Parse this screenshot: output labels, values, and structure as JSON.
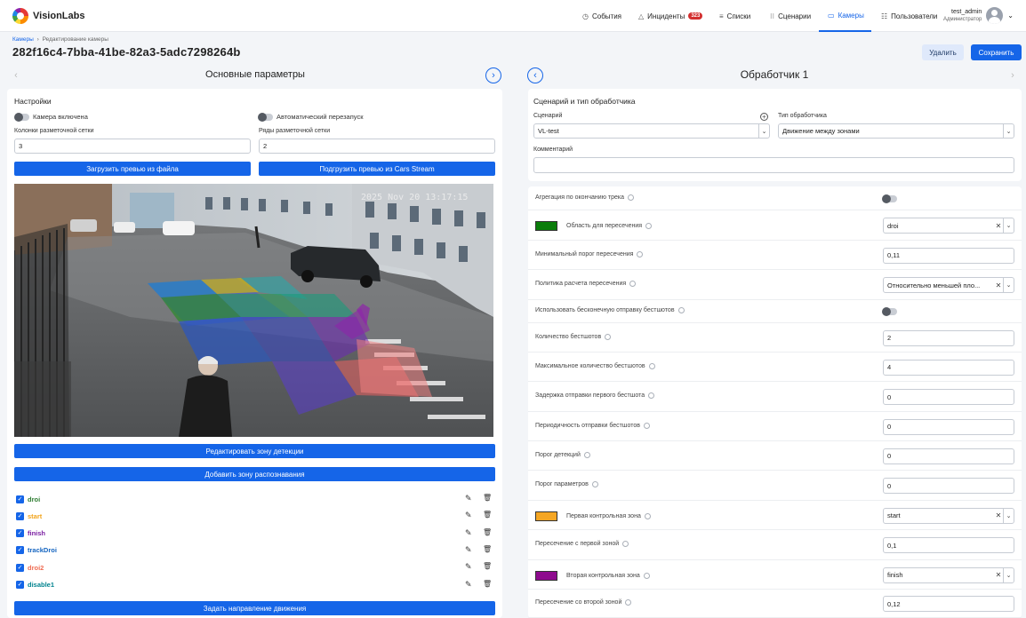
{
  "app": {
    "name": "VisionLabs"
  },
  "nav": [
    {
      "label": "События",
      "icon": "clock-icon"
    },
    {
      "label": "Инциденты",
      "icon": "warning-icon",
      "badge": "323"
    },
    {
      "label": "Списки",
      "icon": "list-icon"
    },
    {
      "label": "Сценарии",
      "icon": "scenario-icon"
    },
    {
      "label": "Камеры",
      "icon": "camera-icon",
      "active": true
    },
    {
      "label": "Пользователи",
      "icon": "users-icon"
    }
  ],
  "user": {
    "name": "test_admin",
    "role": "Администратор"
  },
  "breadcrumb": {
    "root": "Камеры",
    "sep": "›",
    "current": "Редактирование камеры"
  },
  "page_title": "282f16c4-7bba-41be-82a3-5adc7298264b",
  "actions": {
    "delete": "Удалить",
    "save": "Сохранить"
  },
  "left": {
    "header": "Основные параметры",
    "settings_title": "Настройки",
    "camera_enabled": "Камера включена",
    "auto_restart": "Автоматический перезапуск",
    "grid_cols_label": "Колонки разметочной сетки",
    "grid_cols_value": "3",
    "grid_rows_label": "Ряды разметочной сетки",
    "grid_rows_value": "2",
    "load_preview_file": "Загрузить превью из файла",
    "load_preview_stream": "Подгрузить превью из Cars Stream",
    "overlay_timestamp": "2025 Nov 20 13:17:15",
    "edit_detection_zone": "Редактировать зону детекции",
    "add_recognition_zone": "Добавить зону распознавания",
    "zones": [
      {
        "name": "droi",
        "color": "#2e7d32"
      },
      {
        "name": "start",
        "color": "#f2a41c"
      },
      {
        "name": "finish",
        "color": "#7b1fa2"
      },
      {
        "name": "trackDroi",
        "color": "#1565c0"
      },
      {
        "name": "droi2",
        "color": "#ef6c52"
      },
      {
        "name": "disable1",
        "color": "#00838f"
      }
    ],
    "set_direction": "Задать направление движения"
  },
  "right": {
    "header": "Обработчик 1",
    "section_title": "Сценарий и тип обработчика",
    "scenario_label": "Сценарий",
    "scenario_value": "VL-test",
    "handler_type_label": "Тип обработчика",
    "handler_type_value": "Движение между зонами",
    "comment_label": "Комментарий",
    "comment_value": "",
    "params": [
      {
        "label": "Агрегация по окончанию трека",
        "kind": "toggle"
      },
      {
        "label": "Область для пересечения",
        "kind": "select",
        "value": "droi",
        "swatch": "#0a7d0a",
        "clear": true
      },
      {
        "label": "Минимальный порог пересечения",
        "kind": "input",
        "value": "0,11"
      },
      {
        "label": "Политика расчета пересечения",
        "kind": "select",
        "value": "Относительно меньшей пло...",
        "clear": true
      },
      {
        "label": "Использовать бесконечную отправку бестшотов",
        "kind": "toggle"
      },
      {
        "label": "Количество бестшотов",
        "kind": "input",
        "value": "2"
      },
      {
        "label": "Максимальное количество бестшотов",
        "kind": "input",
        "value": "4"
      },
      {
        "label": "Задержка отправки первого бестшота",
        "kind": "input",
        "value": "0"
      },
      {
        "label": "Периодичность отправки бестшотов",
        "kind": "input",
        "value": "0"
      },
      {
        "label": "Порог детекций",
        "kind": "input",
        "value": "0"
      },
      {
        "label": "Порог параметров",
        "kind": "input",
        "value": "0"
      },
      {
        "label": "Первая контрольная зона",
        "kind": "select",
        "value": "start",
        "swatch": "#f5a623",
        "clear": true
      },
      {
        "label": "Пересечение с первой зоной",
        "kind": "input",
        "value": "0,1"
      },
      {
        "label": "Вторая контрольная зона",
        "kind": "select",
        "value": "finish",
        "swatch": "#8e0a8e",
        "clear": true
      },
      {
        "label": "Пересечение со второй зоной",
        "kind": "input",
        "value": "0,12"
      }
    ]
  },
  "colors": {
    "accent": "#1565e8",
    "badge": "#d32f2f"
  }
}
